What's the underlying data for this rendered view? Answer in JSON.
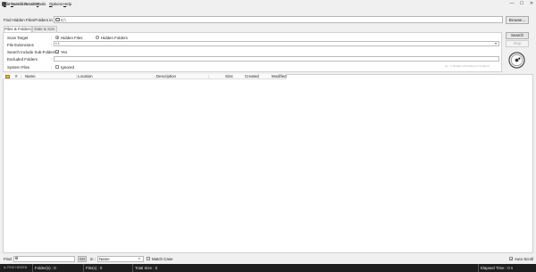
{
  "window": {
    "title": "Find Hidden 0.0.0",
    "minimize_glyph": "—",
    "maximize_glyph": "☐",
    "close_glyph": "✕"
  },
  "menu": [
    {
      "letter": "F",
      "rest": "ile"
    },
    {
      "letter": "S",
      "rest": "earch Results"
    },
    {
      "letter": "T",
      "rest": "ools"
    },
    {
      "letter": "O",
      "rest": "ptions"
    },
    {
      "letter": "H",
      "rest": "elp"
    }
  ],
  "path": {
    "label": "Find Hidden Files/Folders in",
    "colon": ":",
    "value": "C:\\",
    "browse_label": "Browse..."
  },
  "tabs": [
    {
      "label": "Files & Folders",
      "active": true
    },
    {
      "label": "Date & Size",
      "active": false
    }
  ],
  "form": {
    "scan_target": {
      "label": "Scan Target",
      "colon": ":",
      "options": [
        {
          "label": "Hidden Files",
          "selected": true
        },
        {
          "label": "Hidden Folders",
          "selected": false
        }
      ]
    },
    "file_extensions": {
      "label": "File Extensions",
      "colon": ":",
      "value": "*.*"
    },
    "include_sub_folders": {
      "label": "Search Include Sub-Folders",
      "colon": ":",
      "checked": true,
      "option_label": "Yes"
    },
    "excluded_folders": {
      "label": "Excluded Folders",
      "colon": ":",
      "value": ""
    },
    "system_files": {
      "label": "System Files",
      "colon": ":",
      "checked": false,
      "option_label": "Ignored"
    },
    "hint": "eg : C:\\Folder1;D:\\Folder2;C:\\Folder3"
  },
  "actions": {
    "search_label": "Search",
    "stop_label": "Stop"
  },
  "results": {
    "columns": [
      "#",
      "Name",
      "Location",
      "Description",
      "Size",
      "Created",
      "Modified"
    ],
    "rows": []
  },
  "find_bar": {
    "find_label": "Find:",
    "find_value": "",
    "go_label": "GO",
    "in_label": "in :",
    "in_value": "Name",
    "match_case_label": "Match Case",
    "match_case_checked": false,
    "auto_scroll_label": "Auto Scroll",
    "auto_scroll_checked": true
  },
  "status": {
    "ready": "► FIND HIDDEN",
    "folders": "Folder(s) : 0",
    "files": "File(s) : 0",
    "total_size": "Total Size : 0",
    "elapsed": "Elapsed Time : 0 s"
  },
  "colors": {
    "status_bar": "#1e1e1e",
    "accent_folder_icon": "#e8c24a"
  }
}
